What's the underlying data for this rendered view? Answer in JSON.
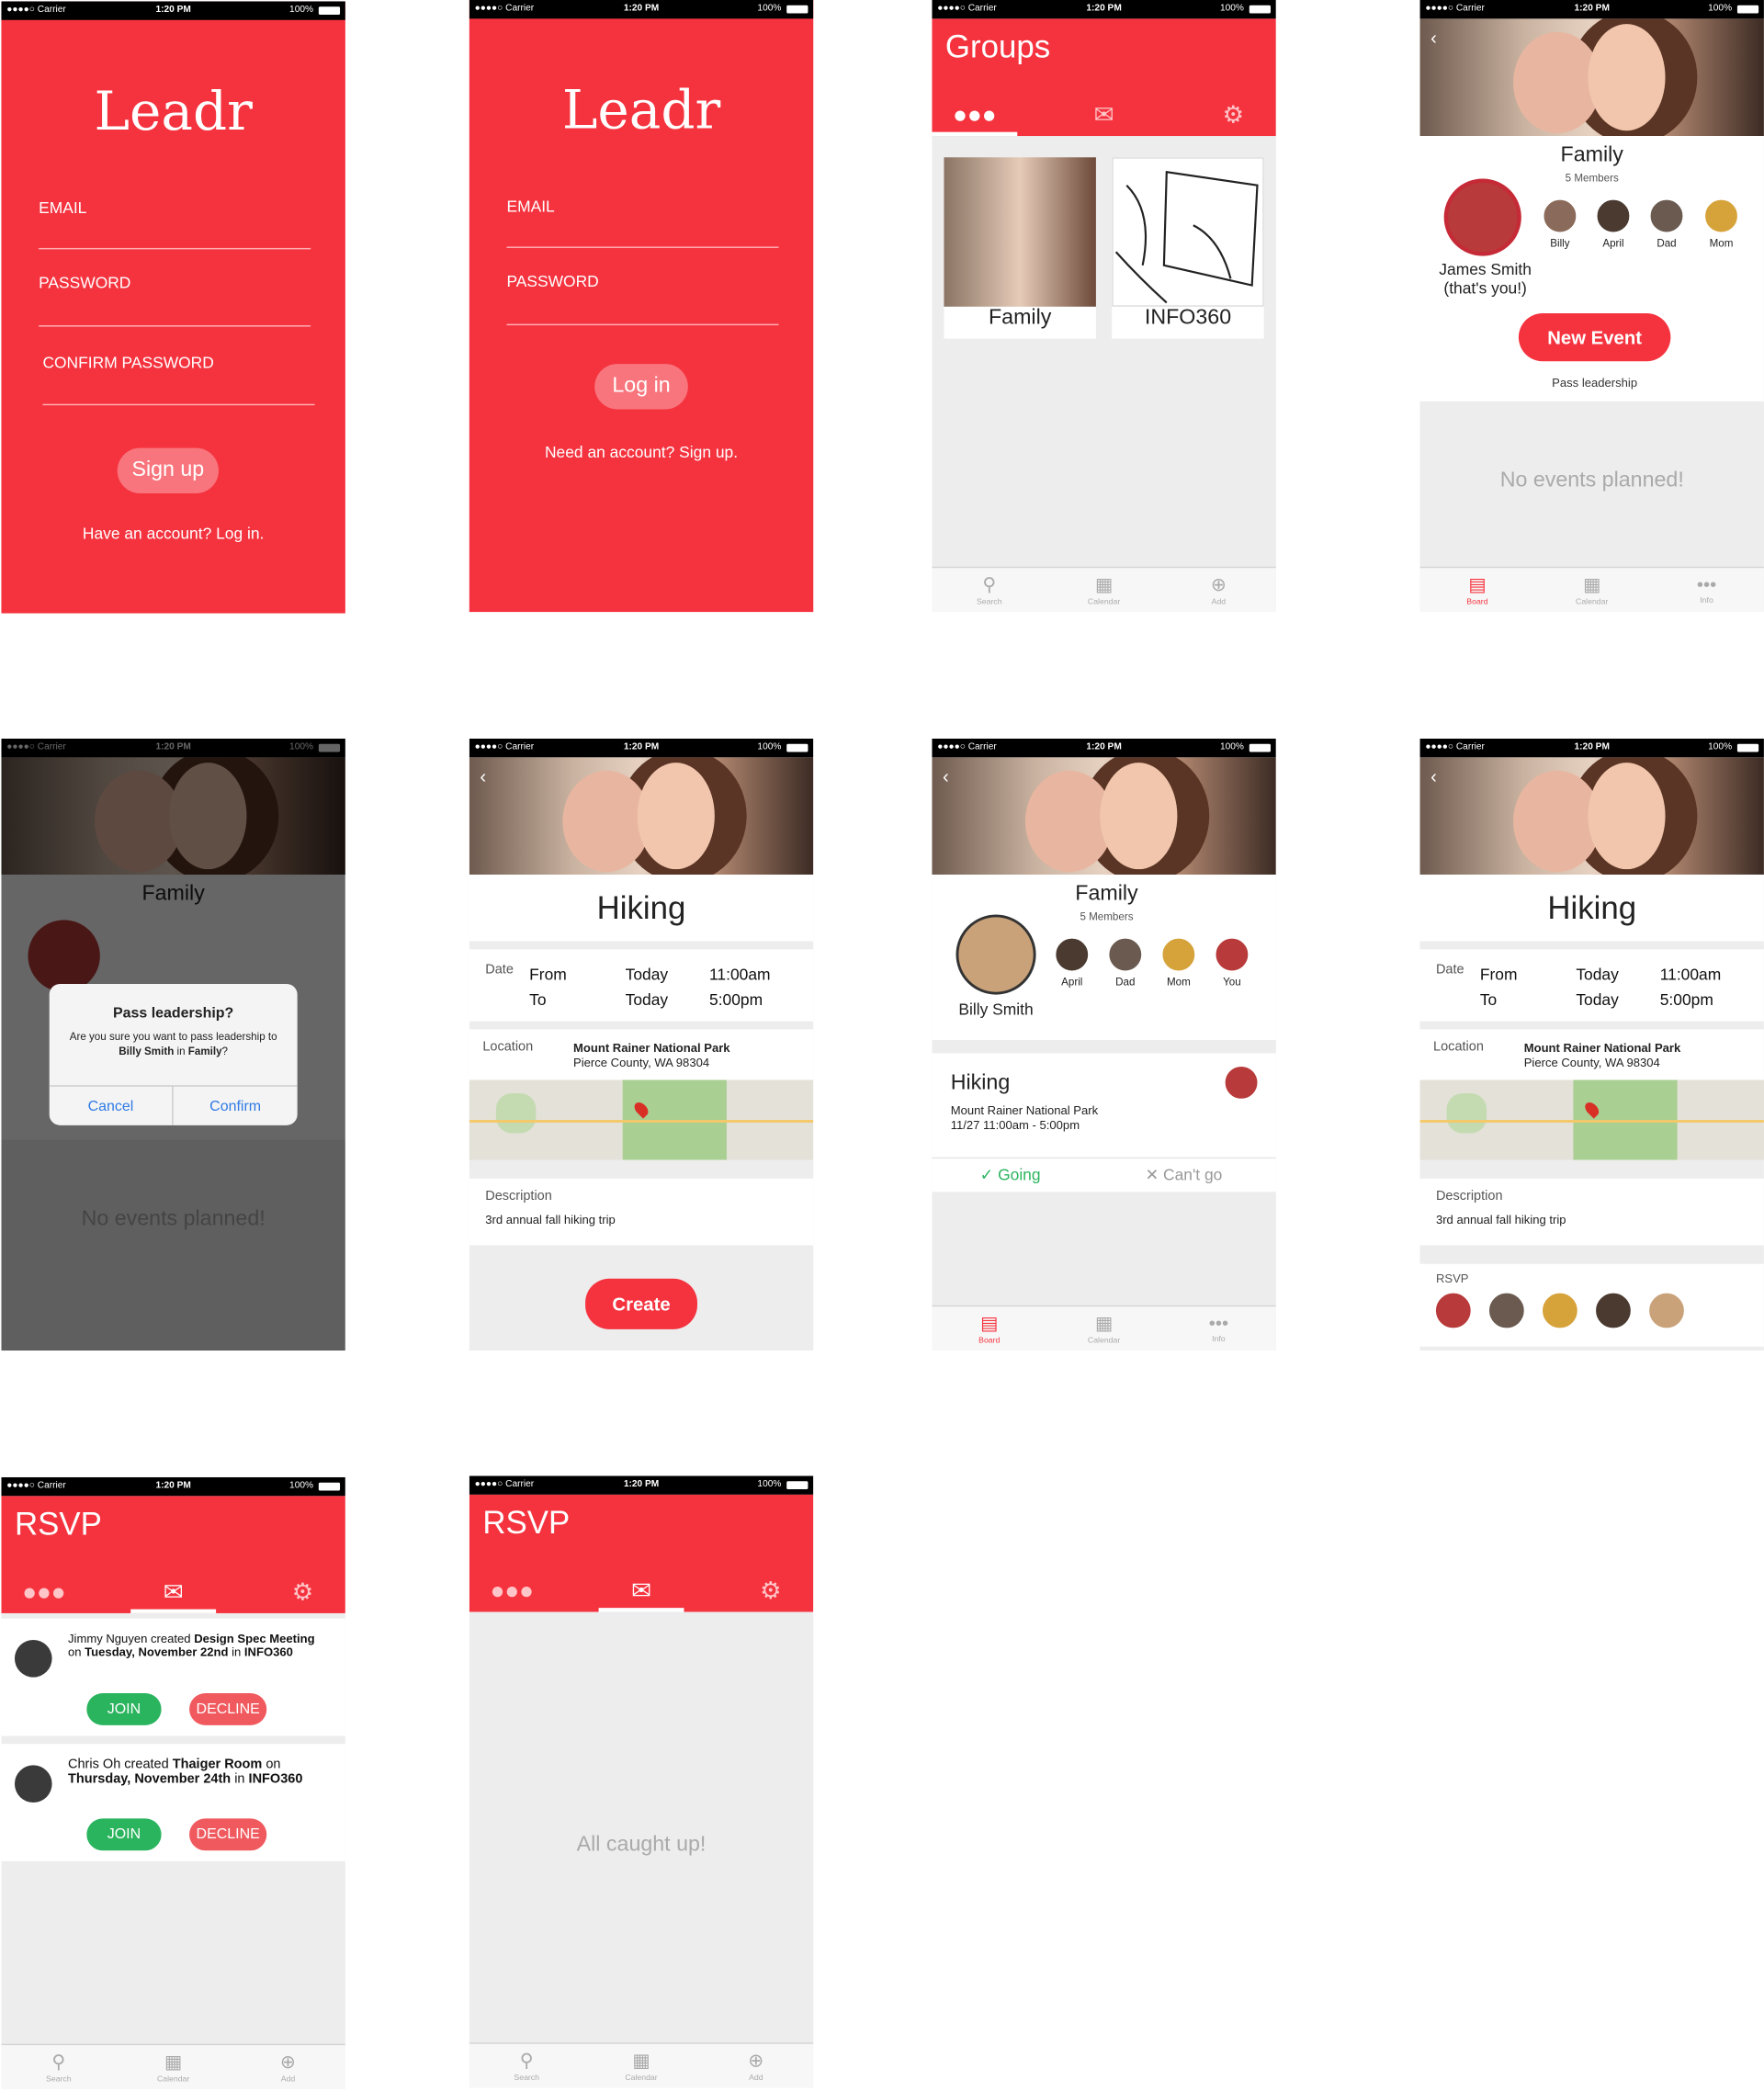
{
  "status": {
    "carrier": "●●●●○ Carrier",
    "time": "1:20 PM",
    "battery": "100%"
  },
  "signup": {
    "logo": "Leadr",
    "email": "EMAIL",
    "password": "PASSWORD",
    "confirm": "CONFIRM PASSWORD",
    "button": "Sign up",
    "link": "Have an account? Log in."
  },
  "login": {
    "logo": "Leadr",
    "email": "EMAIL",
    "password": "PASSWORD",
    "button": "Log in",
    "link": "Need an account? Sign up."
  },
  "groups": {
    "title": "Groups",
    "cards": [
      {
        "name": "Family"
      },
      {
        "name": "INFO360"
      }
    ],
    "nav": [
      "Search",
      "Calendar",
      "Add"
    ]
  },
  "family": {
    "name": "Family",
    "count": "5 Members",
    "leader": "James Smith",
    "leader_note": "(that's you!)",
    "members": [
      "Billy",
      "April",
      "Dad",
      "Mom"
    ],
    "new_event": "New Event",
    "pass": "Pass leadership",
    "empty": "No events planned!",
    "nav": [
      "Board",
      "Calendar",
      "Info"
    ]
  },
  "dialog": {
    "title": "Pass leadership?",
    "msg_pre": "Are you sure you want to pass leadership to ",
    "msg_name": "Billy Smith",
    "msg_mid": " in ",
    "msg_group": "Family",
    "msg_end": "?",
    "cancel": "Cancel",
    "confirm": "Confirm"
  },
  "event": {
    "title": "Hiking",
    "date_label": "Date",
    "from": "From",
    "to": "To",
    "from_day": "Today",
    "from_time": "11:00am",
    "to_day": "Today",
    "to_time": "5:00pm",
    "loc_label": "Location",
    "loc_name": "Mount Rainer National Park",
    "loc_addr": "Pierce County, WA 98304",
    "desc_label": "Description",
    "desc": "3rd annual fall hiking trip",
    "create": "Create",
    "rsvp_label": "RSVP"
  },
  "board": {
    "name": "Family",
    "count": "5 Members",
    "leader": "Billy Smith",
    "members": [
      "April",
      "Dad",
      "Mom",
      "You"
    ],
    "event_title": "Hiking",
    "event_loc": "Mount Rainer National Park",
    "event_time": "11/27 11:00am - 5:00pm",
    "going": "Going",
    "cant": "Can't go"
  },
  "rsvp": {
    "title": "RSVP",
    "items": [
      {
        "who": "Jimmy Nguyen",
        "act": " created ",
        "what": "Design Spec Meeting",
        "on": " on ",
        "when": "Tuesday, November 22nd",
        "in": " in ",
        "grp": "INFO360"
      },
      {
        "who": "Chris Oh",
        "act": " created ",
        "what": "Thaiger Room",
        "on": " on ",
        "when": "Thursday, November 24th",
        "in": " in ",
        "grp": "INFO360"
      }
    ],
    "join": "JOIN",
    "decline": "DECLINE",
    "empty": "All caught up!"
  },
  "colors": {
    "brand": "#f5333f",
    "going": "#2bb45e",
    "decline": "#f05a5f",
    "link": "#2f7ae5"
  },
  "icons": [
    "people-icon",
    "mail-icon",
    "gear-icon",
    "search-icon",
    "calendar-icon",
    "add-icon",
    "board-icon",
    "more-icon",
    "back-icon",
    "check-icon",
    "x-icon"
  ]
}
